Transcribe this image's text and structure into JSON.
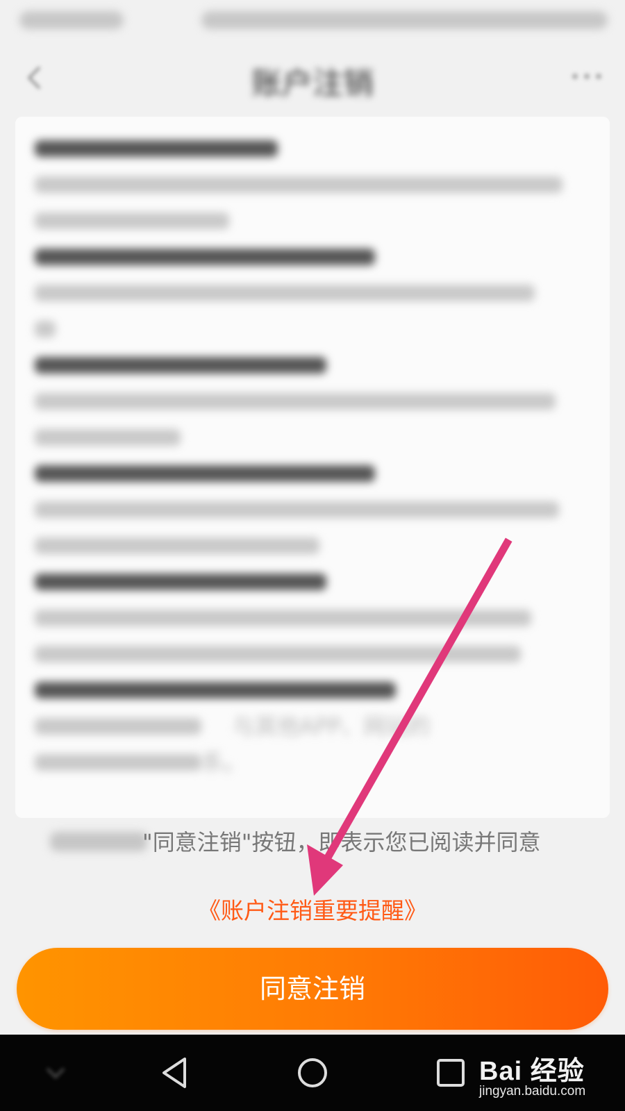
{
  "header": {
    "title": "账户注销"
  },
  "content": {
    "partial_visible_text": "与其他APP、网站的",
    "partial_visible_text_2": "系。"
  },
  "agreement": {
    "text": "\"同意注销\"按钮，即表示您已阅读并同意",
    "link_label": "《账户注销重要提醒》"
  },
  "confirm_button": {
    "label": "同意注销"
  },
  "nav_bar": {
    "items": [
      "hide-icon",
      "back-triangle-icon",
      "home-circle-icon",
      "recent-square-icon"
    ]
  },
  "watermark": {
    "logo": "Bai 经验",
    "url": "jingyan.baidu.com"
  },
  "colors": {
    "accent": "#ff5a16",
    "button_start": "#ff9400",
    "button_end": "#ff5c06",
    "annotation_arrow": "#e0387a"
  }
}
